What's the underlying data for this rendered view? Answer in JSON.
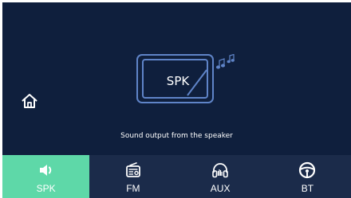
{
  "main": {
    "mode_label": "SPK",
    "status_text": "Sound output from the speaker"
  },
  "nav": {
    "tabs": [
      {
        "label": "SPK",
        "icon": "speaker-icon",
        "active": true
      },
      {
        "label": "FM",
        "icon": "radio-icon",
        "active": false
      },
      {
        "label": "AUX",
        "icon": "headphones-icon",
        "active": false
      },
      {
        "label": "BT",
        "icon": "steering-wheel-icon",
        "active": false
      }
    ]
  },
  "colors": {
    "background": "#0f1f3d",
    "nav_background": "#1b2b4a",
    "active_tab": "#5ed8a8",
    "line_art": "#5f84c8"
  }
}
